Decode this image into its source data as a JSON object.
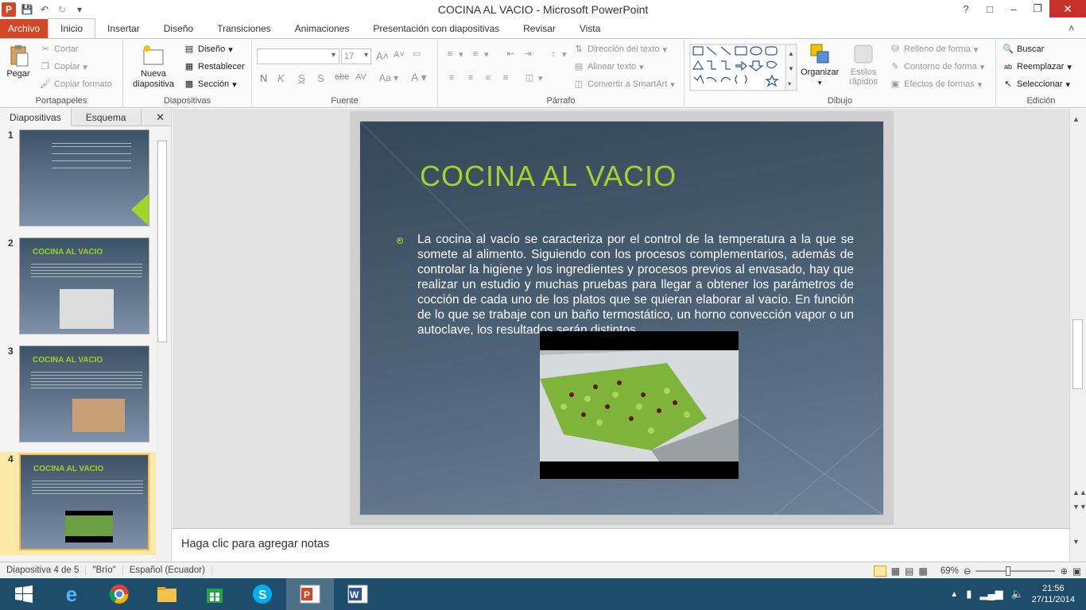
{
  "window": {
    "title": "COCINA AL VACIO  -  Microsoft PowerPoint",
    "app_logo": "P"
  },
  "tabs": [
    "Archivo",
    "Inicio",
    "Insertar",
    "Diseño",
    "Transiciones",
    "Animaciones",
    "Presentación con diapositivas",
    "Revisar",
    "Vista"
  ],
  "ribbon": {
    "portapapeles": {
      "paste": "Pegar",
      "cut": "Cortar",
      "copy": "Copiar",
      "format_painter": "Copiar formato",
      "label": "Portapapeles"
    },
    "diapositivas": {
      "new_slide": "Nueva diapositiva",
      "layout": "Diseño",
      "reset": "Restablecer",
      "section": "Sección",
      "label": "Diapositivas"
    },
    "fuente": {
      "size": "17",
      "label": "Fuente"
    },
    "parrafo": {
      "text_direction": "Dirección del texto",
      "align_text": "Alinear texto",
      "smartart": "Convertir a SmartArt",
      "label": "Párrafo"
    },
    "dibujo": {
      "arrange": "Organizar",
      "quick_styles": "Estilos rápidos",
      "fill": "Relleno de forma",
      "outline": "Contorno de forma",
      "effects": "Efectos de formas",
      "label": "Dibujo"
    },
    "edicion": {
      "find": "Buscar",
      "replace": "Reemplazar",
      "select": "Seleccionar",
      "label": "Edición"
    }
  },
  "left_pane": {
    "tab_slides": "Diapositivas",
    "tab_outline": "Esquema",
    "thumbs": [
      {
        "num": "1",
        "title": ""
      },
      {
        "num": "2",
        "title": "COCINA AL VACIO"
      },
      {
        "num": "3",
        "title": "COCINA AL VACIO"
      },
      {
        "num": "4",
        "title": "COCINA AL VACIO"
      }
    ]
  },
  "slide": {
    "title": "COCINA AL VACIO",
    "body": "La cocina al vacío se caracteriza por el control de la temperatura a la que se somete al alimento. Siguiendo con los procesos complementarios, además de controlar la higiene y los ingredientes y procesos previos al envasado, hay que realizar un estudio y muchas pruebas para llegar a obtener los parámetros de cocción de cada uno de los platos que se quieran elaborar al vacío. En función de lo que se trabaje con un baño termostático, un horno convección vapor o un autoclave, los resultados serán distintos."
  },
  "notes": {
    "placeholder": "Haga clic para agregar notas"
  },
  "status": {
    "slide_info": "Diapositiva 4 de 5",
    "theme": "\"Brío\"",
    "language": "Español (Ecuador)",
    "zoom": "69%"
  },
  "taskbar": {
    "time": "21:56",
    "date": "27/11/2014"
  }
}
